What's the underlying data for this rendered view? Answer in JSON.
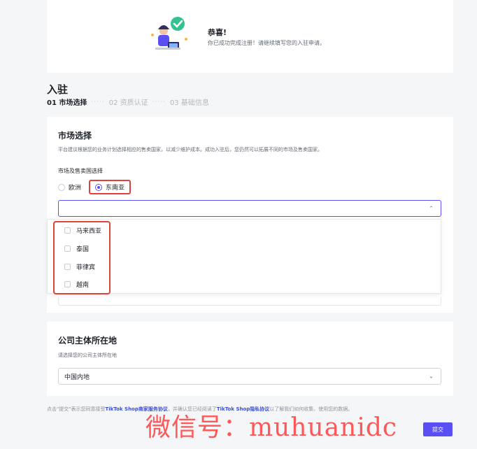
{
  "banner": {
    "title": "恭喜!",
    "subtitle": "你已成功完成注册！请继续填写您的入驻申请。"
  },
  "page": {
    "title": "入驻",
    "steps": [
      {
        "label": "01 市场选择",
        "active": true
      },
      {
        "label": "02 资质认证",
        "active": false
      },
      {
        "label": "03 基础信息",
        "active": false
      }
    ]
  },
  "market": {
    "title": "市场选择",
    "description": "平台建议根据您的业务计划选择相应的售卖国家，以减少维护成本。成功入驻后，您仍然可以拓展不同的市场及售卖国家。",
    "field_label": "市场及售卖国选择",
    "radios": [
      {
        "label": "欧洲",
        "checked": false
      },
      {
        "label": "东南亚",
        "checked": true
      }
    ],
    "select_value": "",
    "dropdown_options": [
      "马来西亚",
      "泰国",
      "菲律宾",
      "越南"
    ]
  },
  "company": {
    "title": "公司主体所在地",
    "description": "请选择您的公司主体所在地",
    "select_value": "中国内地"
  },
  "footer": {
    "note_prefix": "点击\"提交\"表示您同意接受",
    "link1": "TikTok Shop商家服务协议",
    "note_mid": "，并确认您已经阅读了",
    "link2": "TikTok Shop隐私协议",
    "note_suffix": "以了解我们如何收集、使用您的数据。"
  },
  "submit_label": "提交",
  "watermark": "微信号：muhuanidc",
  "colors": {
    "accent": "#5a4ff3",
    "highlight_border": "#e0413a",
    "watermark": "#ff4b4b"
  }
}
